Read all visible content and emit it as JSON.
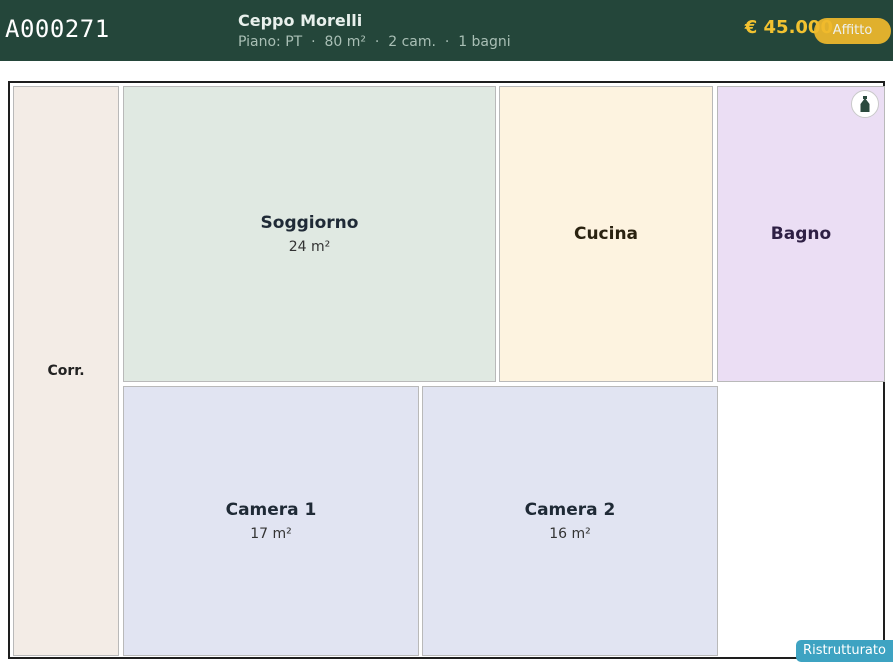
{
  "header": {
    "listing_id": "A000271",
    "locality": "Ceppo Morelli",
    "specs": "Piano: PT  ·  80 m²  ·  2 cam.  ·  1 bagni",
    "price": "€ 45.000",
    "contract_badge": "Affitto"
  },
  "floorplan": {
    "rooms": {
      "corridor": {
        "name": "Corr."
      },
      "living": {
        "name": "Soggiorno",
        "area": "24 m²"
      },
      "kitchen": {
        "name": "Cucina"
      },
      "bathroom": {
        "name": "Bagno",
        "icon": "shower-icon"
      },
      "bedroom1": {
        "name": "Camera 1",
        "area": "17 m²"
      },
      "bedroom2": {
        "name": "Camera 2",
        "area": "16 m²"
      }
    }
  },
  "status_badge": "Ristrutturato",
  "colors": {
    "header_bg": "#24463a",
    "price": "#f2c230",
    "contract_badge": "#f0ba2c",
    "status_badge": "#3ea3c2"
  }
}
